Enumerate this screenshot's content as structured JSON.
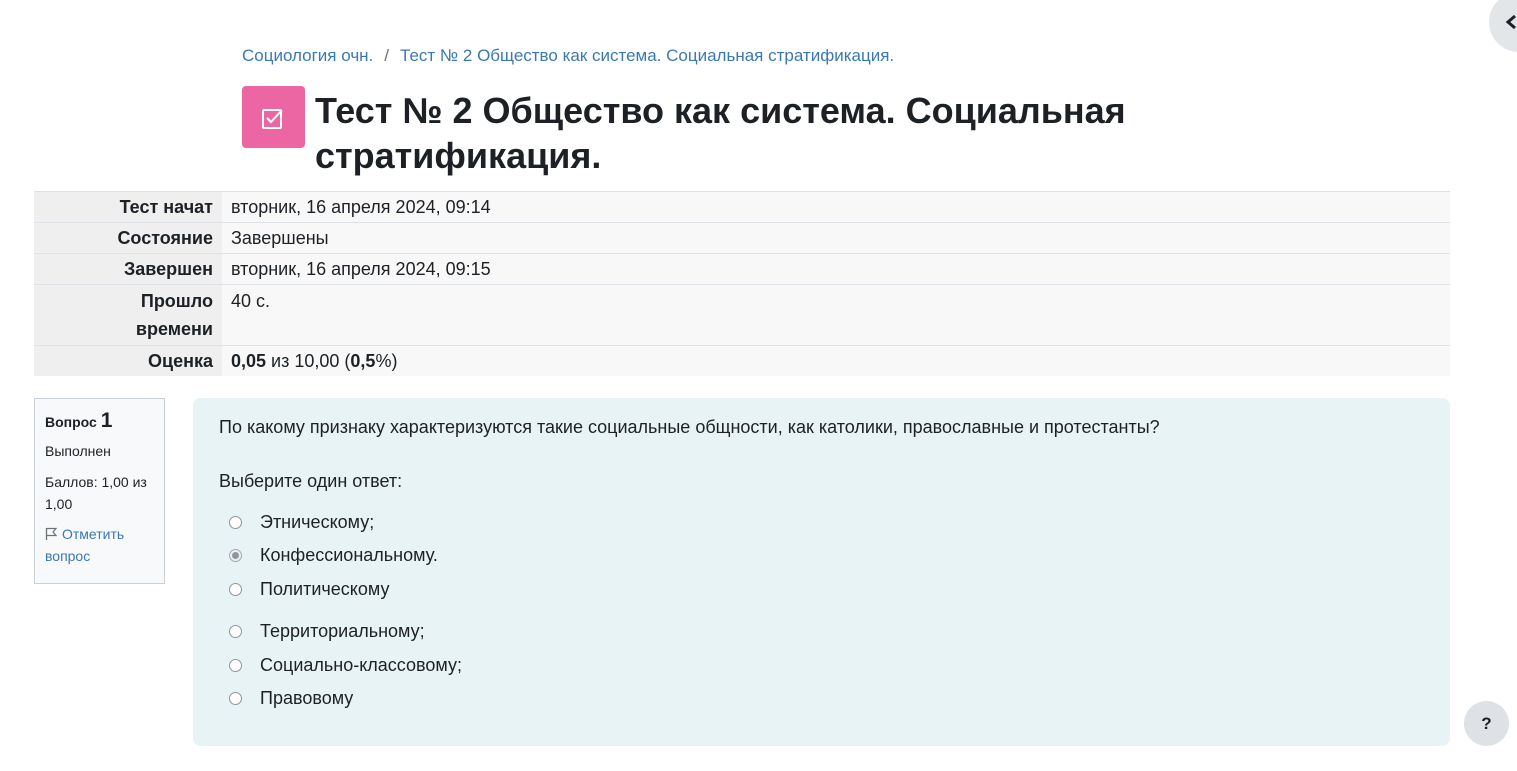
{
  "breadcrumb": {
    "course": "Социология очн.",
    "separator": "/",
    "activity": "Тест № 2 Общество как система. Социальная стратификация."
  },
  "page_title": "Тест № 2 Общество как система. Социальная стратификация.",
  "summary": {
    "started_label": "Тест начат",
    "started_value": "вторник, 16 апреля 2024, 09:14",
    "state_label": "Состояние",
    "state_value": "Завершены",
    "completed_label": "Завершен",
    "completed_value": "вторник, 16 апреля 2024, 09:15",
    "time_label_line1": "Прошло",
    "time_label_line2": "времени",
    "time_value": "40 с.",
    "grade_label": "Оценка",
    "grade_score": "0,05",
    "grade_mid": " из 10,00 (",
    "grade_percent": "0,5",
    "grade_end": "%)"
  },
  "question_info": {
    "label": "Вопрос",
    "number": "1",
    "state": "Выполнен",
    "marks": "Баллов: 1,00 из 1,00",
    "flag_label": "Отметить вопрос"
  },
  "question": {
    "text": "По какому признаку характеризуются такие социальные общности, как католики, православные и протестанты?",
    "prompt": "Выберите один ответ:",
    "answers": [
      {
        "label": "Этническому;",
        "checked": false
      },
      {
        "label": "Конфессиональному.",
        "checked": true
      },
      {
        "label": "Политическому",
        "checked": false
      },
      {
        "label": "Территориальному;",
        "checked": false
      },
      {
        "label": "Социально-классовому;",
        "checked": false
      },
      {
        "label": "Правовому",
        "checked": false
      }
    ]
  },
  "help": {
    "label": "?"
  },
  "icons": {
    "activity": "quiz-checkbox-icon",
    "flag": "flag-icon",
    "drawer": "chevron-left-icon"
  },
  "colors": {
    "link": "#3a78b4",
    "activity_icon_bg": "#eb66a2",
    "question_bg": "#e7f3f5"
  }
}
